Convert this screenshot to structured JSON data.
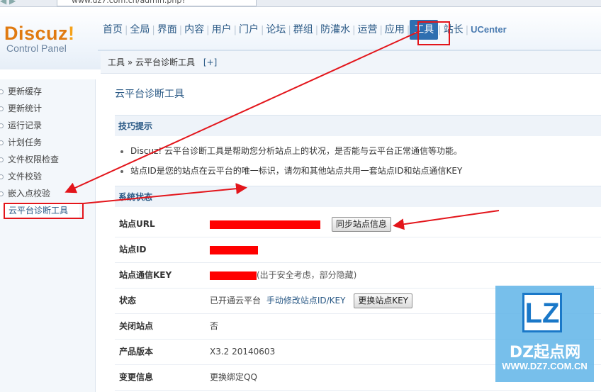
{
  "browser": {
    "url": "www.dz7.com.cn/admin.php?"
  },
  "logo": {
    "brand": "Discuz",
    "bang": "!",
    "sub": "Control Panel"
  },
  "topnav": {
    "items": [
      "首页",
      "全局",
      "界面",
      "内容",
      "用户",
      "门户",
      "论坛",
      "群组",
      "防灌水",
      "运营",
      "应用",
      "工具",
      "站长",
      "UCenter"
    ],
    "active": "工具"
  },
  "breadcrumb": {
    "root": "工具",
    "sep": "»",
    "current": "云平台诊断工具",
    "plus": "[+]"
  },
  "sidebar": {
    "items": [
      "更新缓存",
      "更新统计",
      "运行记录",
      "计划任务",
      "文件权限检查",
      "文件校验",
      "嵌入点校验",
      "云平台诊断工具"
    ],
    "active": "云平台诊断工具"
  },
  "main": {
    "title": "云平台诊断工具",
    "tips_heading": "技巧提示",
    "tips": [
      "Discuz! 云平台诊断工具是帮助您分析站点上的状况，是否能与云平台正常通信等功能。",
      "站点ID是您的站点在云平台的唯一标识，请勿和其他站点共用一套站点ID和站点通信KEY"
    ],
    "status_heading": "系统状态",
    "rows": {
      "site_url": {
        "label": "站点URL",
        "button": "同步站点信息"
      },
      "site_id": {
        "label": "站点ID"
      },
      "site_key": {
        "label": "站点通信KEY",
        "note": "(出于安全考虑，部分隐藏)"
      },
      "status": {
        "label": "状态",
        "value": "已开通云平台",
        "link": "手动修改站点ID/KEY",
        "button": "更换站点KEY"
      },
      "close": {
        "label": "关闭站点",
        "value": "否"
      },
      "version": {
        "label": "产品版本",
        "value": "X3.2 20140603"
      },
      "change": {
        "label": "变更信息",
        "link": "更换绑定QQ"
      }
    }
  },
  "watermark": {
    "logo": "LZ",
    "name": "DZ起点网",
    "site": "WWW.DZ7.COM.CN"
  },
  "colors": {
    "annotation": "#e3151b",
    "accent": "#2b5a86",
    "active_tab": "#2f6fb0",
    "logo": "#e07a10"
  }
}
